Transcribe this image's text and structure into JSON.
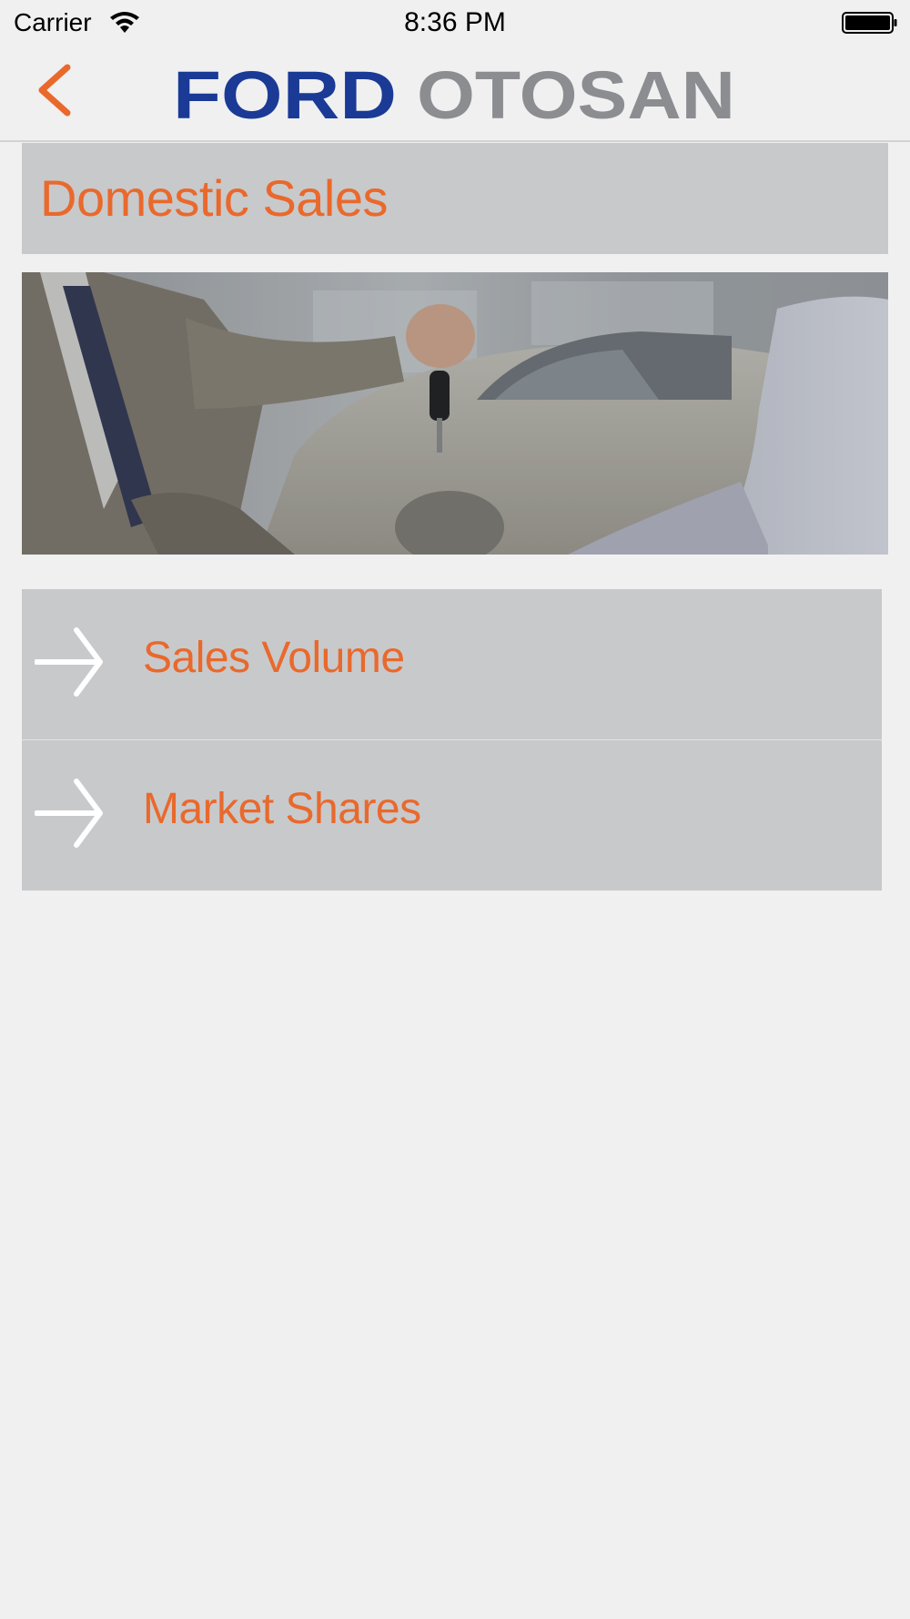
{
  "status_bar": {
    "carrier": "Carrier",
    "time": "8:36 PM",
    "wifi_icon": "wifi-icon",
    "battery_icon": "battery-icon"
  },
  "nav": {
    "back_icon": "chevron-left-icon",
    "logo": {
      "brand_word": "FORD",
      "brand_second_word": "OTOSAN",
      "primary_color": "#1a3a96",
      "secondary_color": "#8c8d91"
    }
  },
  "page": {
    "title": "Domestic Sales",
    "hero_image": "Salesperson handing car keys to customer in a showroom"
  },
  "menu": {
    "items": [
      {
        "label": "Sales Volume",
        "icon": "arrow-right-icon"
      },
      {
        "label": "Market Shares",
        "icon": "arrow-right-icon"
      }
    ]
  },
  "colors": {
    "accent": "#e9692c",
    "panel": "#c8c9cb",
    "background": "#f0f0f1"
  }
}
